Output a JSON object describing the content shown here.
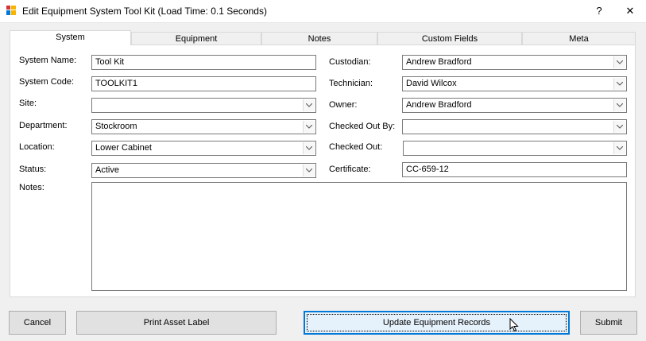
{
  "window": {
    "title": "Edit Equipment System Tool Kit (Load Time: 0.1 Seconds)",
    "help": "?",
    "close": "✕"
  },
  "tabs": [
    "System",
    "Equipment",
    "Notes",
    "Custom Fields",
    "Meta"
  ],
  "left": {
    "system_name": {
      "label": "System Name:",
      "value": "Tool Kit"
    },
    "system_code": {
      "label": "System Code:",
      "value": "TOOLKIT1"
    },
    "site": {
      "label": "Site:",
      "value": ""
    },
    "department": {
      "label": "Department:",
      "value": "Stockroom"
    },
    "location": {
      "label": "Location:",
      "value": "Lower Cabinet"
    },
    "status": {
      "label": "Status:",
      "value": "Active"
    },
    "notes": {
      "label": "Notes:",
      "value": ""
    }
  },
  "right": {
    "custodian": {
      "label": "Custodian:",
      "value": "Andrew Bradford"
    },
    "technician": {
      "label": "Technician:",
      "value": "David Wilcox"
    },
    "owner": {
      "label": "Owner:",
      "value": "Andrew Bradford"
    },
    "checked_out_by": {
      "label": "Checked Out By:",
      "value": ""
    },
    "checked_out": {
      "label": "Checked Out:",
      "value": ""
    },
    "certificate": {
      "label": "Certificate:",
      "value": "CC-659-12"
    }
  },
  "buttons": {
    "cancel": "Cancel",
    "print": "Print Asset Label",
    "update": "Update Equipment Records",
    "submit": "Submit"
  }
}
